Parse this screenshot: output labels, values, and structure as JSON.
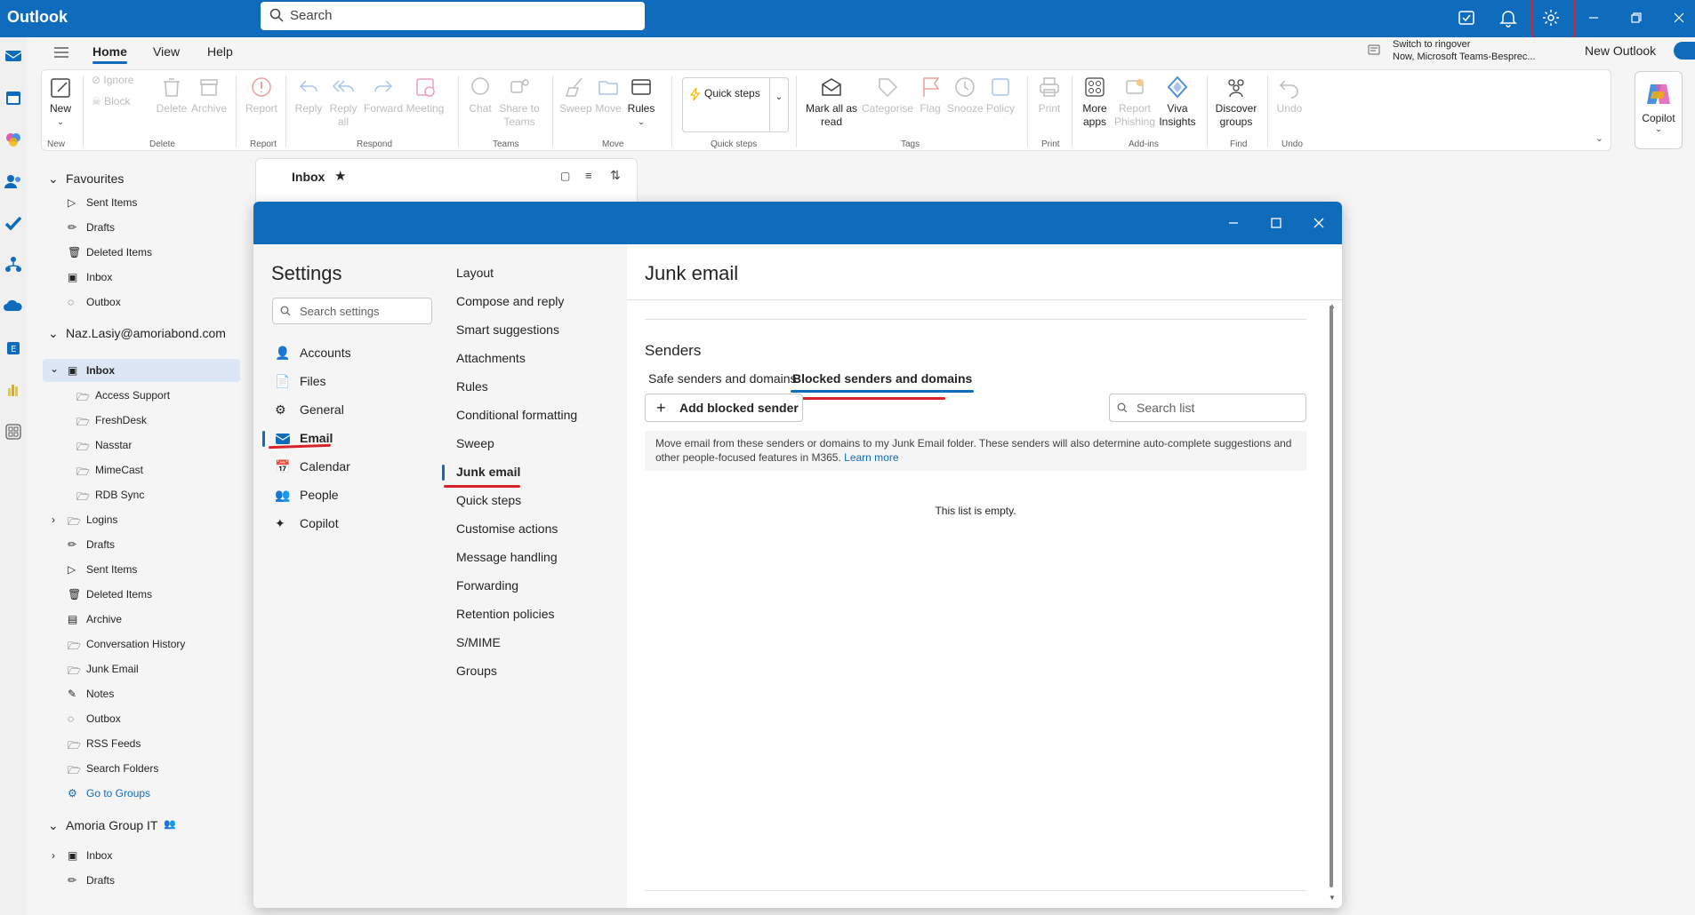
{
  "titlebar": {
    "app_name": "Outlook",
    "search_placeholder": "Search"
  },
  "ribbon_tabs": {
    "tabs": [
      "Home",
      "View",
      "Help"
    ],
    "ringover_title": "Switch to ringover",
    "ringover_sub": "Now, Microsoft Teams-Besprec...",
    "new_outlook": "New Outlook"
  },
  "ribbon": {
    "new": "New",
    "ignore": "Ignore",
    "block": "Block",
    "delete": "Delete",
    "archive": "Archive",
    "report": "Report",
    "reply": "Reply",
    "reply_all_1": "Reply",
    "reply_all_2": "all",
    "forward": "Forward",
    "meeting": "Meeting",
    "chat": "Chat",
    "share_teams_1": "Share to",
    "share_teams_2": "Teams",
    "sweep": "Sweep",
    "move": "Move",
    "rules": "Rules",
    "quick_steps": "Quick steps",
    "mark_all_1": "Mark all as",
    "mark_all_2": "read",
    "categorise": "Categorise",
    "flag": "Flag",
    "snooze": "Snooze",
    "policy": "Policy",
    "print": "Print",
    "more_apps_1": "More",
    "more_apps_2": "apps",
    "report_phish_1": "Report",
    "report_phish_2": "Phishing",
    "viva_1": "Viva",
    "viva_2": "Insights",
    "discover_1": "Discover",
    "discover_2": "groups",
    "undo": "Undo",
    "copilot": "Copilot",
    "groups": {
      "new": "New",
      "delete": "Delete",
      "report": "Report",
      "respond": "Respond",
      "teams": "Teams",
      "move": "Move",
      "quick_steps": "Quick steps",
      "tags": "Tags",
      "print": "Print",
      "addins": "Add-ins",
      "find": "Find",
      "undo": "Undo"
    }
  },
  "folders": {
    "favourites_header": "Favourites",
    "favourites": [
      "Sent Items",
      "Drafts",
      "Deleted Items",
      "Inbox",
      "Outbox"
    ],
    "account": "Naz.Lasiy@amoriabond.com",
    "inbox": "Inbox",
    "inbox_sub": [
      "Access Support",
      "FreshDesk",
      "Nasstar",
      "MimeCast",
      "RDB Sync"
    ],
    "account_folders": [
      "Logins",
      "Drafts",
      "Sent Items",
      "Deleted Items",
      "Archive",
      "Conversation History",
      "Junk Email",
      "Notes",
      "Outbox",
      "RSS Feeds",
      "Search Folders"
    ],
    "go_to_groups": "Go to Groups",
    "group_header": "Amoria Group IT",
    "group_folders": [
      "Inbox",
      "Drafts"
    ]
  },
  "msglist": {
    "title": "Inbox"
  },
  "settings": {
    "title": "Settings",
    "search_placeholder": "Search settings",
    "categories": [
      "Accounts",
      "Files",
      "General",
      "Email",
      "Calendar",
      "People",
      "Copilot"
    ],
    "email_subs": [
      "Layout",
      "Compose and reply",
      "Smart suggestions",
      "Attachments",
      "Rules",
      "Conditional formatting",
      "Sweep",
      "Junk email",
      "Quick steps",
      "Customise actions",
      "Message handling",
      "Forwarding",
      "Retention policies",
      "S/MIME",
      "Groups"
    ],
    "pane_title": "Junk email",
    "senders_header": "Senders",
    "tab_safe": "Safe senders and domains",
    "tab_blocked": "Blocked senders and domains",
    "add_button": "Add blocked sender",
    "search_list_placeholder": "Search list",
    "info_text": "Move email from these senders or domains to my Junk Email folder. These senders will also determine auto-complete suggestions and other people-focused features in M365.",
    "learn_more": "Learn more",
    "empty_text": "This list is empty."
  },
  "colors": {
    "brand": "#0f6cbd",
    "annotation_red": "#d9232b"
  }
}
